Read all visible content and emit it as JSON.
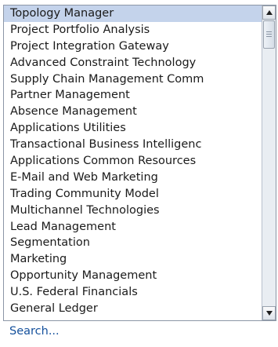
{
  "dropdown": {
    "items": [
      {
        "label": "Topology Manager",
        "selected": true
      },
      {
        "label": "Project Portfolio Analysis"
      },
      {
        "label": "Project Integration Gateway"
      },
      {
        "label": "Advanced Constraint Technology"
      },
      {
        "label": "Supply Chain Management Comm"
      },
      {
        "label": "Partner Management"
      },
      {
        "label": "Absence Management"
      },
      {
        "label": "Applications Utilities"
      },
      {
        "label": "Transactional Business Intelligenc"
      },
      {
        "label": "Applications Common Resources"
      },
      {
        "label": "E-Mail and Web Marketing"
      },
      {
        "label": "Trading Community Model"
      },
      {
        "label": "Multichannel Technologies"
      },
      {
        "label": "Lead Management"
      },
      {
        "label": "Segmentation"
      },
      {
        "label": "Marketing"
      },
      {
        "label": "Opportunity Management"
      },
      {
        "label": "U.S. Federal Financials"
      },
      {
        "label": "General Ledger"
      }
    ],
    "search_label": "Search...",
    "scroll_position": 0.0
  },
  "icons": {
    "scroll_up": "scroll-up-arrow-icon",
    "scroll_down": "scroll-down-arrow-icon"
  },
  "colors": {
    "selected_background": "#c4d3eb",
    "link": "#14509c"
  }
}
